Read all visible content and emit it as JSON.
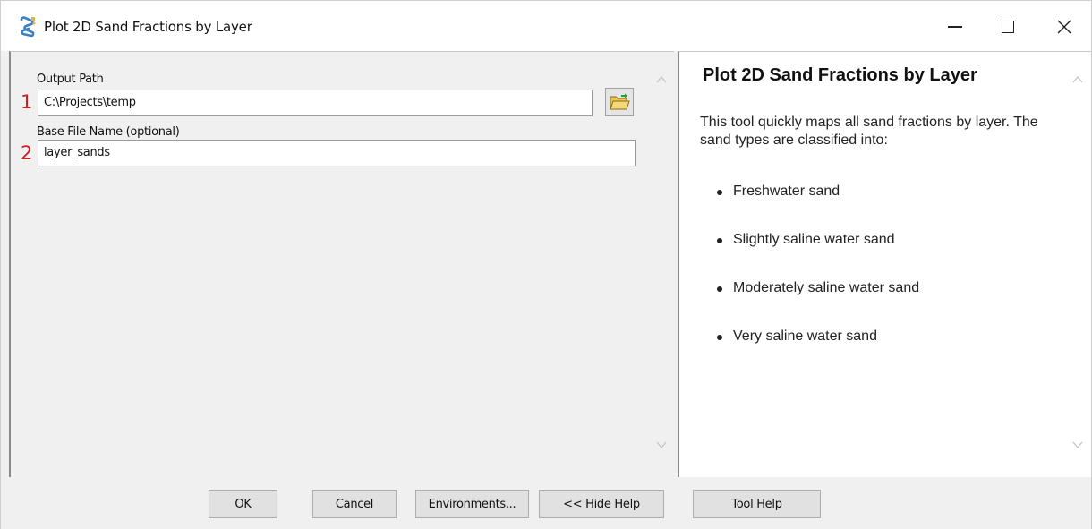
{
  "window": {
    "title": "Plot 2D Sand Fractions by Layer",
    "app_icon": "toolbox-script-icon"
  },
  "parameters": {
    "output_path": {
      "marker": "1",
      "label": "Output Path",
      "value": "C:\\Projects\\temp",
      "browse_icon": "folder-open-icon"
    },
    "base_file_name": {
      "marker": "2",
      "label": "Base File Name (optional)",
      "value": "layer_sands"
    }
  },
  "help": {
    "title": "Plot 2D Sand Fractions by Layer",
    "description": "This tool quickly maps all sand fractions by layer. The sand types are classified into:",
    "items": [
      "Freshwater sand",
      "Slightly saline water sand",
      "Moderately saline water sand",
      "Very saline water sand"
    ]
  },
  "buttons": {
    "ok": "OK",
    "cancel": "Cancel",
    "environments": "Environments...",
    "hide_help": "<< Hide Help",
    "tool_help": "Tool Help"
  },
  "colors": {
    "marker": "#d11f1f",
    "panel_bg": "#f0f0f0",
    "help_bg": "#ffffff"
  }
}
